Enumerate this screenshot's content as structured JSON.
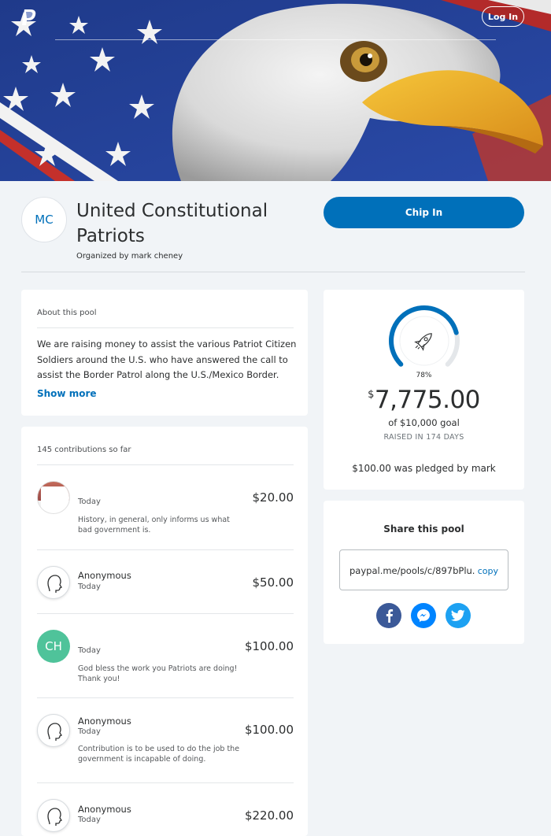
{
  "header": {
    "login_label": "Log In"
  },
  "pool": {
    "initials": "MC",
    "title": "United Constitutional Patriots",
    "organizer": "Organized by mark cheney",
    "chip_in_label": "Chip In"
  },
  "about": {
    "heading": "About this pool",
    "text": "We are raising money to assist the various Patriot Citizen Soldiers around the U.S. who have answered the call to assist the Border Patrol along the U.S./Mexico Border. They",
    "show_more": "Show more"
  },
  "contributions": {
    "heading": "145 contributions so far",
    "items": [
      {
        "avatar": "photo",
        "name": "",
        "date": "Today",
        "message": "History, in general, only informs us what bad government is.",
        "amount": "$20.00"
      },
      {
        "avatar": "anonymous",
        "name": "Anonymous",
        "date": "Today",
        "message": "",
        "amount": "$50.00"
      },
      {
        "avatar": "initials",
        "initials": "CH",
        "name": "",
        "date": "Today",
        "message": "God bless the work you Patriots are doing! Thank you!",
        "amount": "$100.00"
      },
      {
        "avatar": "anonymous",
        "name": "Anonymous",
        "date": "Today",
        "message": "Contribution is to be used to do the job the government is incapable of doing.",
        "amount": "$100.00"
      },
      {
        "avatar": "anonymous",
        "name": "Anonymous",
        "date": "Today",
        "message": "",
        "amount": "$220.00"
      }
    ]
  },
  "progress": {
    "percent": 78,
    "percent_label": "78%",
    "currency_symbol": "$",
    "raised_amount": "7,775.00",
    "goal": "of $10,000 goal",
    "days": "RAISED IN 174 DAYS",
    "pledged": "$100.00 was pledged by mark"
  },
  "share": {
    "title": "Share this pool",
    "link": "paypal.me/pools/c/897bPlu...",
    "copy_label": "copy",
    "icons": [
      "facebook-icon",
      "messenger-icon",
      "twitter-icon"
    ]
  },
  "colors": {
    "brand_blue": "#0070ba",
    "page_bg": "#f1f4f7",
    "initials_green": "#4fc39a",
    "facebook": "#3b5998",
    "messenger": "#0084ff",
    "twitter": "#1da1f2"
  }
}
